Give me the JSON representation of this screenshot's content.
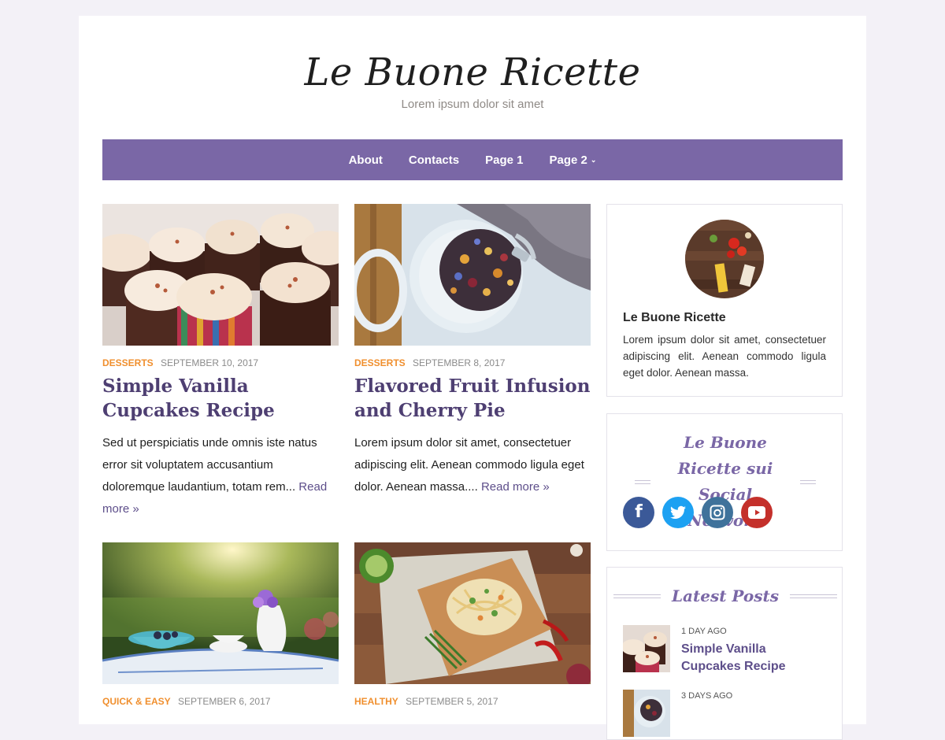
{
  "site": {
    "title": "Le Buone Ricette",
    "tagline": "Lorem ipsum dolor sit amet"
  },
  "nav": {
    "items": [
      "About",
      "Contacts",
      "Page 1",
      "Page 2"
    ]
  },
  "posts": [
    {
      "category": "DESSERTS",
      "date": "SEPTEMBER 10, 2017",
      "title": "Simple Vanilla Cupcakes Recipe",
      "excerpt": "Sed ut perspiciatis unde omnis iste natus error sit voluptatem accusantium doloremque laudantium, totam rem...",
      "read_more": "Read more »"
    },
    {
      "category": "DESSERTS",
      "date": "SEPTEMBER 8, 2017",
      "title": "Flavored Fruit Infusion and Cherry Pie",
      "excerpt": "Lorem ipsum dolor sit amet, consectetuer adipiscing elit. Aenean commodo ligula eget dolor. Aenean massa....",
      "read_more": "Read more »"
    },
    {
      "category": "QUICK & EASY",
      "date": "SEPTEMBER 6, 2017"
    },
    {
      "category": "HEALTHY",
      "date": "SEPTEMBER 5, 2017"
    }
  ],
  "about_widget": {
    "name": "Le Buone Ricette",
    "text": "Lorem ipsum dolor sit amet, consectetuer adipiscing elit. Aenean commodo ligula eget dolor. Aenean massa."
  },
  "social_widget": {
    "title": "Le Buone Ricette sui Social Network",
    "networks": [
      {
        "icon": "facebook-icon",
        "color": "#3b5998"
      },
      {
        "icon": "twitter-icon",
        "color": "#1da1f2"
      },
      {
        "icon": "instagram-icon",
        "color": "#3f729b"
      },
      {
        "icon": "youtube-icon",
        "color": "#c4302b"
      }
    ]
  },
  "latest_posts_widget": {
    "title": "Latest Posts",
    "items": [
      {
        "ago": "1 DAY AGO",
        "title": "Simple Vanilla Cupcakes Recipe"
      },
      {
        "ago": "3 DAYS AGO",
        "title": ""
      }
    ]
  },
  "colors": {
    "accent": "#7a67a6",
    "category": "#f08f2e",
    "title": "#4e3f72",
    "link": "#5d4e8a"
  }
}
